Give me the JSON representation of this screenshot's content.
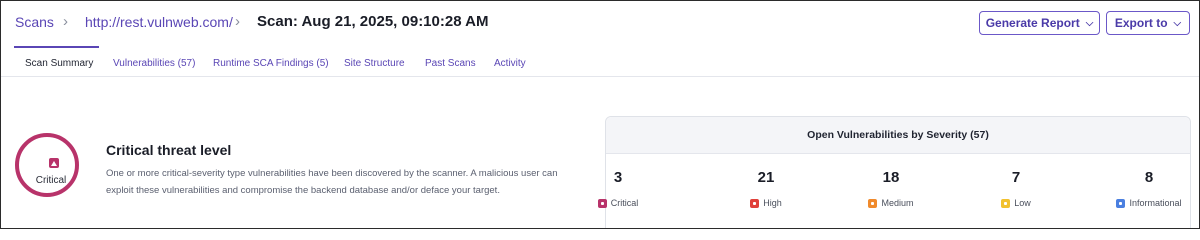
{
  "breadcrumb": {
    "root": "Scans",
    "site": "http://rest.vulnweb.com/",
    "scan_title": "Scan: Aug 21, 2025, 09:10:28 AM"
  },
  "actions": {
    "generate_report": "Generate Report",
    "export_to": "Export to"
  },
  "tabs": [
    {
      "label": "Scan Summary",
      "active": true
    },
    {
      "label": "Vulnerabilities (57)"
    },
    {
      "label": "Runtime SCA Findings (5)"
    },
    {
      "label": "Site Structure"
    },
    {
      "label": "Past Scans"
    },
    {
      "label": "Activity"
    }
  ],
  "threat": {
    "badge_label": "Critical",
    "title": "Critical threat level",
    "description": "One or more critical-severity type vulnerabilities have been discovered by the scanner. A malicious user can exploit these vulnerabilities and compromise the backend database and/or deface your target."
  },
  "severity_panel": {
    "title": "Open Vulnerabilities by Severity (57)",
    "items": [
      {
        "count": "3",
        "label": "Critical",
        "color": "#b8336a"
      },
      {
        "count": "21",
        "label": "High",
        "color": "#e0403a"
      },
      {
        "count": "18",
        "label": "Medium",
        "color": "#f08a2c"
      },
      {
        "count": "7",
        "label": "Low",
        "color": "#f2c12e"
      },
      {
        "count": "8",
        "label": "Informational",
        "color": "#4a7fe0"
      }
    ]
  }
}
